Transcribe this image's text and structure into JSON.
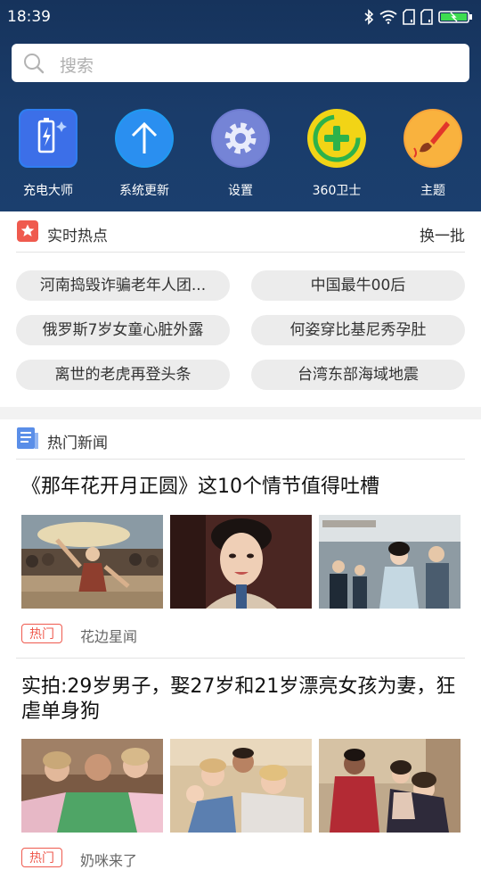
{
  "status_bar": {
    "time": "18:39"
  },
  "search": {
    "placeholder": "搜索"
  },
  "apps": [
    {
      "label": "充电大师",
      "icon": "battery-icon"
    },
    {
      "label": "系统更新",
      "icon": "arrow-up-icon"
    },
    {
      "label": "设置",
      "icon": "gear-icon"
    },
    {
      "label": "360卫士",
      "icon": "plus-shield-icon"
    },
    {
      "label": "主题",
      "icon": "paintbrush-icon"
    }
  ],
  "hot_topics": {
    "title": "实时热点",
    "refresh_label": "换一批",
    "items": [
      "河南捣毁诈骗老年人团...",
      "中国最牛00后",
      "俄罗斯7岁女童心脏外露",
      "何姿穿比基尼秀孕肚",
      "离世的老虎再登头条",
      "台湾东部海域地震"
    ]
  },
  "news": {
    "title": "热门新闻",
    "articles": [
      {
        "headline": "《那年花开月正圆》这10个情节值得吐槽",
        "tag": "热门",
        "source": "花边星闻",
        "images": [
          "drama-crowd-scene",
          "drama-actress-portrait",
          "drama-poster"
        ]
      },
      {
        "headline": "实拍:29岁男子，娶27岁和21岁漂亮女孩为妻，狂虐单身狗",
        "tag": "热门",
        "source": "奶咪来了",
        "images": [
          "couple-kiss-photo",
          "family-selfie-photo",
          "family-portrait-photo"
        ]
      }
    ]
  },
  "colors": {
    "accent_red": "#ef5a4e",
    "header_navy": "#1a3c6a"
  }
}
